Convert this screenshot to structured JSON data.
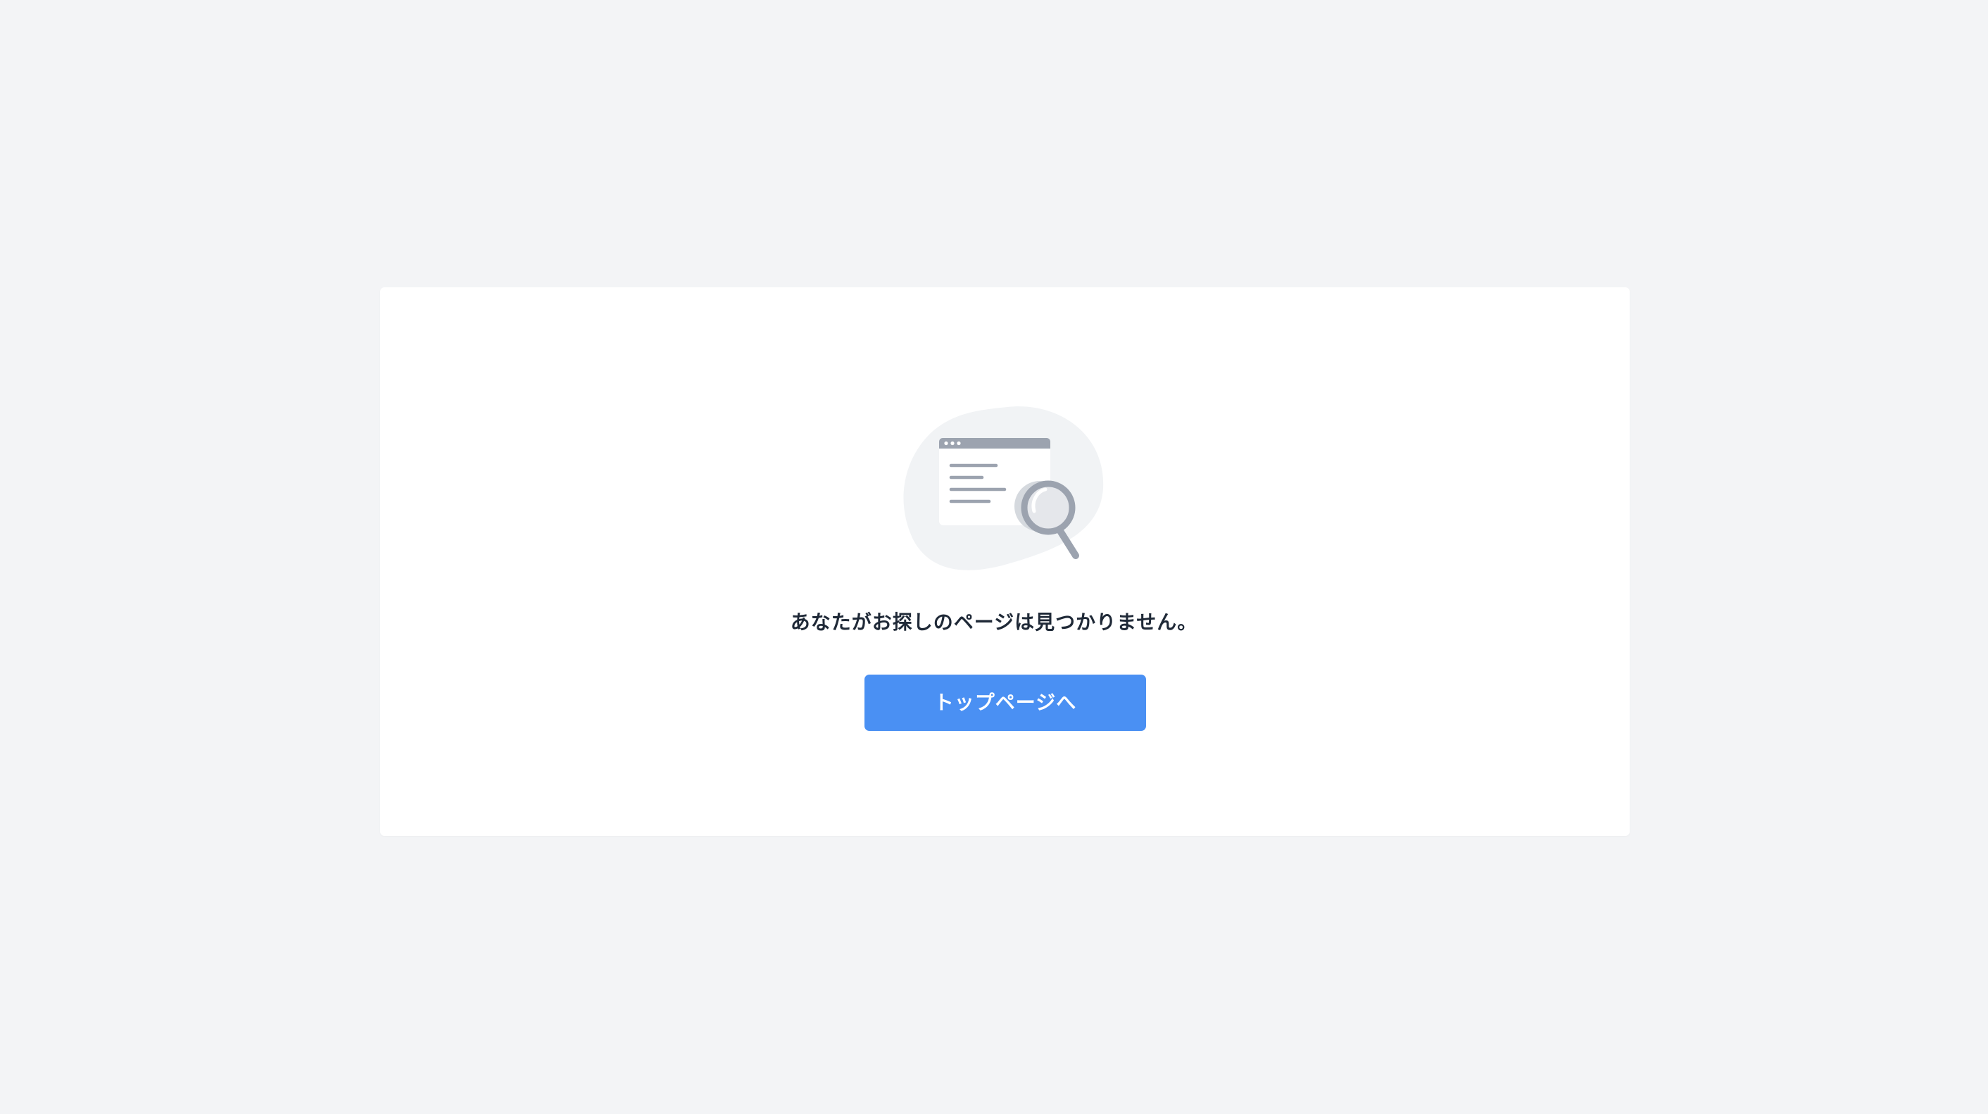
{
  "page": {
    "background_color": "#f3f4f6"
  },
  "illustration": {
    "icon": "page-not-found-magnifier-icon"
  },
  "message": {
    "text": "あなたがお探しのページは見つかりません。"
  },
  "button": {
    "label": "トップページへ",
    "color": "#4a90f3"
  }
}
